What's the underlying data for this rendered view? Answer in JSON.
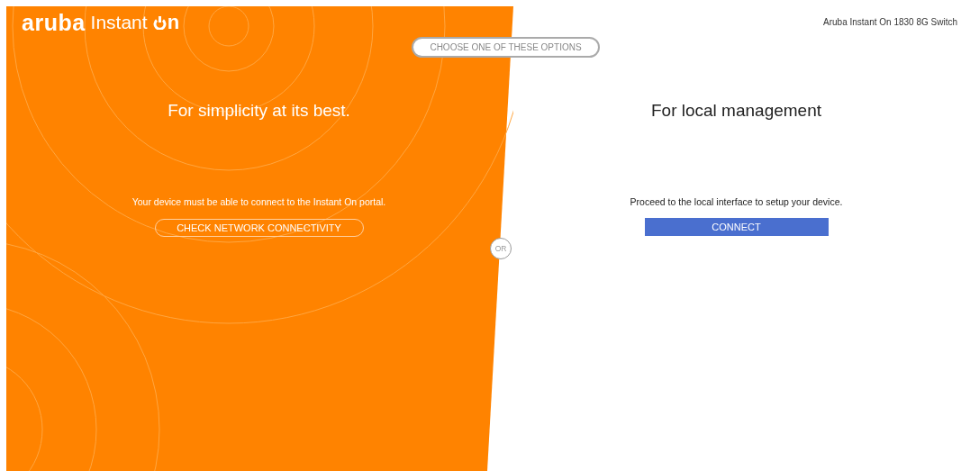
{
  "logo": {
    "brand": "aruba",
    "product": "Instant",
    "suffix": "n"
  },
  "device_name": "Aruba Instant On 1830 8G Switch",
  "prompt": "CHOOSE ONE OF THESE OPTIONS",
  "options": [
    {
      "kind": "cloud",
      "title": "For simplicity at its best.",
      "description": "Your device must be able to connect to the Instant On portal.",
      "button": "CHECK NETWORK CONNECTIVITY"
    },
    {
      "kind": "local",
      "title": "For local management",
      "description": "Proceed to the local interface to setup your device.",
      "button": "CONNECT"
    }
  ],
  "separator": "OR"
}
